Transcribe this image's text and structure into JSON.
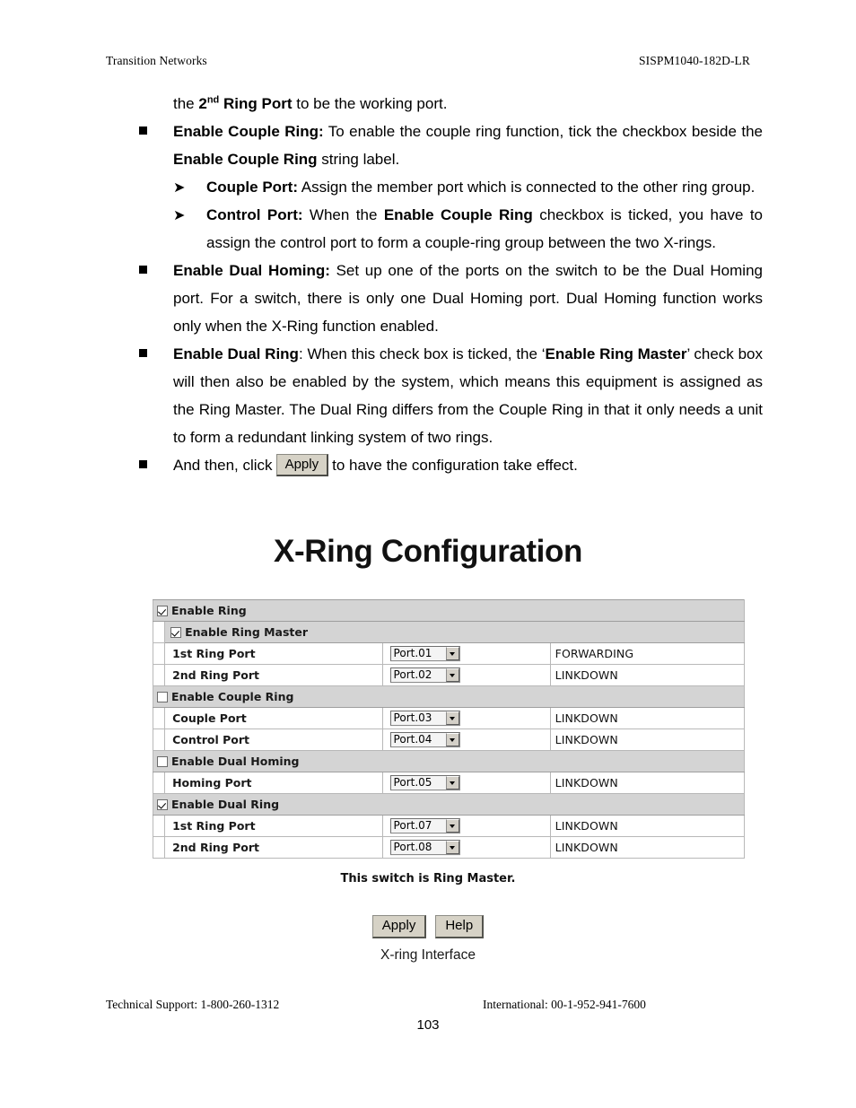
{
  "header": {
    "left": "Transition Networks",
    "right": "SISPM1040-182D-LR"
  },
  "body": {
    "line_first_prefix": "the ",
    "line_first_bold": "2",
    "line_first_sup": "nd",
    "line_first_bold2": " Ring Port",
    "line_first_rest": " to be the working port.",
    "items": [
      {
        "term": "Enable Couple Ring:",
        "text": " To enable the couple ring function, tick the checkbox beside the ",
        "term2": "Enable Couple Ring",
        "text2": " string label."
      },
      {
        "term": "Couple Port:",
        "text": " Assign the member port which is connected to the other ring group."
      },
      {
        "term": "Control Port:",
        "text": " When the ",
        "term2": "Enable Couple Ring",
        "text2": " checkbox is ticked, you have to assign the control port to form a couple-ring group between the two X-rings."
      },
      {
        "term": "Enable Dual Homing:",
        "text": " Set up one of the ports on the switch to be the Dual Homing port. For a switch, there is only one Dual Homing port. Dual Homing function works only when the X-Ring function enabled."
      },
      {
        "term": "Enable Dual Ring",
        "text": ": When this check box is ticked, the ‘",
        "term2": "Enable Ring Master",
        "text2": "’ check box will then also be enabled by the system, which means this equipment is assigned as the Ring Master. The Dual Ring differs from the Couple Ring in that it only needs a unit to form a redundant linking system of two rings."
      }
    ],
    "apply_line_before": "And then, click",
    "apply_button_label": "Apply",
    "apply_line_after": "to have the configuration take effect."
  },
  "figure": {
    "title": "X-Ring Configuration",
    "caption": "X-ring Interface",
    "note": "This switch is Ring Master.",
    "buttons": [
      {
        "label": "Apply",
        "name": "apply-button"
      },
      {
        "label": "Help",
        "name": "help-button"
      }
    ],
    "rows": [
      {
        "kind": "group",
        "checked": true,
        "label": "Enable Ring"
      },
      {
        "kind": "group-sub",
        "checked": true,
        "label": "Enable Ring Master"
      },
      {
        "kind": "data",
        "label": "1st Ring Port",
        "port": "Port.01",
        "status": "FORWARDING"
      },
      {
        "kind": "data",
        "label": "2nd Ring Port",
        "port": "Port.02",
        "status": "LINKDOWN"
      },
      {
        "kind": "group",
        "checked": false,
        "label": "Enable Couple Ring"
      },
      {
        "kind": "data",
        "label": "Couple Port",
        "port": "Port.03",
        "status": "LINKDOWN"
      },
      {
        "kind": "data",
        "label": "Control Port",
        "port": "Port.04",
        "status": "LINKDOWN"
      },
      {
        "kind": "group",
        "checked": false,
        "label": "Enable Dual Homing"
      },
      {
        "kind": "data",
        "label": "Homing Port",
        "port": "Port.05",
        "status": "LINKDOWN"
      },
      {
        "kind": "group",
        "checked": true,
        "label": "Enable Dual Ring"
      },
      {
        "kind": "data",
        "label": "1st Ring Port",
        "port": "Port.07",
        "status": "LINKDOWN"
      },
      {
        "kind": "data",
        "label": "2nd Ring Port",
        "port": "Port.08",
        "status": "LINKDOWN"
      }
    ]
  },
  "footer": {
    "left": "Technical Support: 1-800-260-1312",
    "right": "International: 00-1-952-941-7600",
    "page_number": "103"
  },
  "colors": {
    "group_row_bg": "#d4d4d4",
    "button_face": "#d6d2c6",
    "table_border": "#b8b8b8"
  }
}
